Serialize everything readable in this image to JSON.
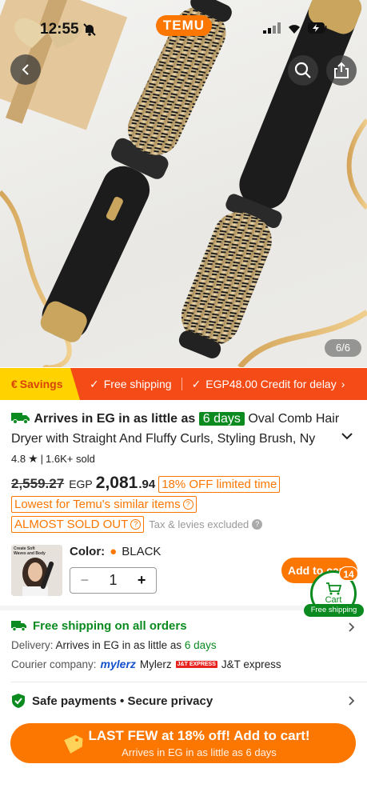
{
  "status_bar": {
    "time": "12:55"
  },
  "header": {
    "brand": "TEMU",
    "image_counter": "6/6"
  },
  "promo_strip": {
    "savings": "Savings",
    "free_shipping": "Free shipping",
    "credit": "EGP48.00 Credit for delay"
  },
  "product": {
    "arrival_prefix": "Arrives in EG in as little as",
    "arrival_days": "6 days",
    "title": "Oval Comb Hair Dryer with Straight And Fluffy Curls, Styling Brush, Ny",
    "rating_value": "4.8",
    "sold": "1.6K+ sold",
    "old_price": "2,559.27",
    "currency": "EGP",
    "price_int": "2,081",
    "price_dec": ".94",
    "discount_chip": "18% OFF limited time",
    "lowest_chip": "Lowest for Temu's similar items",
    "almost_sold_chip": "ALMOST SOLD OUT",
    "tax_note": "Tax & levies excluded"
  },
  "variant": {
    "thumb_caption": "Create Soft Waves and Body",
    "color_label": "Color:",
    "color_value": "BLACK",
    "quantity": "1",
    "minus": "−",
    "plus": "+",
    "add_to_cart": "Add to cart"
  },
  "cart": {
    "label": "Cart",
    "count": "14",
    "free_shipping": "Free shipping"
  },
  "shipping": {
    "headline": "Free shipping on all orders",
    "delivery_label": "Delivery:",
    "delivery_text": "Arrives in EG in as little as",
    "delivery_days": "6 days",
    "courier_label": "Courier company:",
    "courier_logo1": "mylerz",
    "courier1": "Mylerz",
    "courier_logo2": "J&T EXPRESS",
    "courier2": "J&T express"
  },
  "safety": {
    "text": "Safe payments • Secure privacy"
  },
  "cta": {
    "main": "LAST FEW at 18% off! Add to cart!",
    "sub": "Arrives in EG in as little as 6 days"
  },
  "colors": {
    "brand_orange": "#fb7701",
    "promo_red": "#f54b17",
    "green": "#0a8a1f",
    "savings_yellow": "#ffd200"
  }
}
